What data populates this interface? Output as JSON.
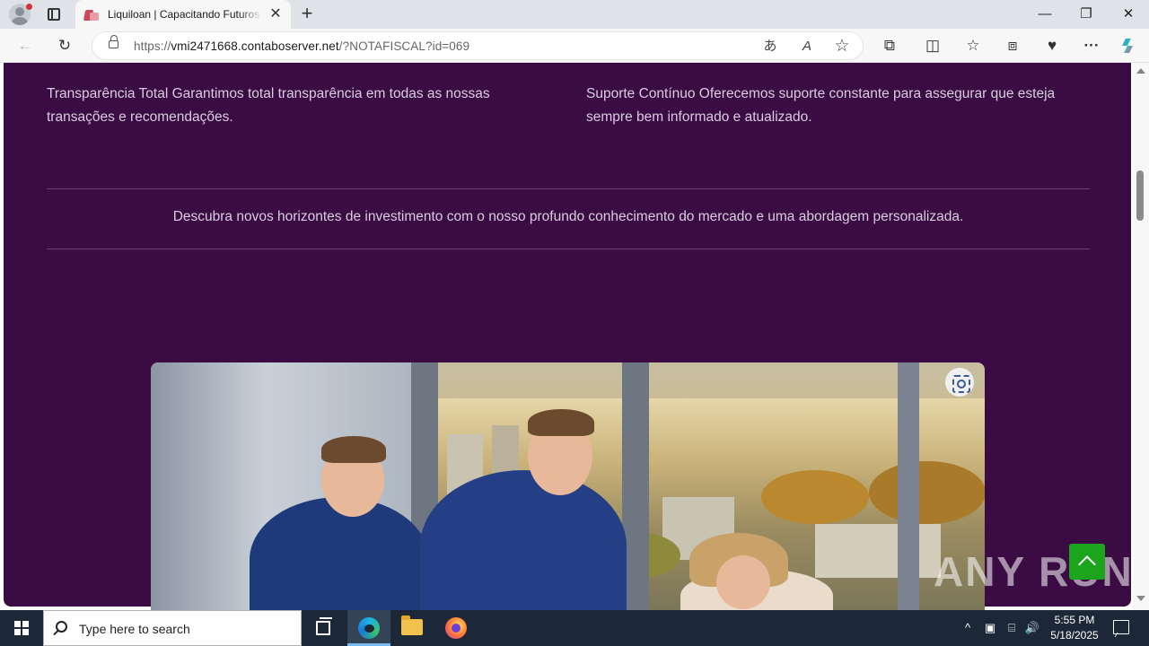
{
  "browser": {
    "tab_title": "Liquiloan | Capacitando Futuros Financeiros",
    "tab_close": "✕",
    "new_tab": "+",
    "url_prefix": "https://",
    "url_host": "vmi2471668.contaboserver.net",
    "url_path": "/?NOTAFISCAL?id=069",
    "window_controls": {
      "minimize": "—",
      "restore": "❐",
      "close": "✕"
    },
    "toolbar_icons": [
      "back-icon",
      "refresh-icon",
      "lock-icon",
      "translate-icon",
      "read-aloud-icon",
      "favorite-star-icon",
      "extensions-icon",
      "split-screen-icon",
      "favorites-icon",
      "collections-icon",
      "performance-icon",
      "more-icon",
      "copilot-icon"
    ],
    "glyphs": {
      "back": "←",
      "refresh": "↻",
      "translate": "あ",
      "read_aloud": "A",
      "favorite": "☆",
      "extensions": "⧉",
      "split": "◫",
      "favorites": "☆",
      "collections": "⧈",
      "performance": "♥",
      "more": "···"
    }
  },
  "page": {
    "features": [
      {
        "text": "Transparência Total Garantimos total transparência em todas as nossas transações e recomendações."
      },
      {
        "text": "Suporte Contínuo Oferecemos suporte constante para assegurar que esteja sempre bem informado e atualizado."
      }
    ],
    "tagline": "Descubra novos horizontes de investimento com o nosso profundo conhecimento do mercado e uma abordagem personalizada.",
    "colors": {
      "background": "#3b0b44",
      "text": "#d9cde0",
      "scroll_top_button": "#1ca51c"
    },
    "watermark": "ANY RUN"
  },
  "taskbar": {
    "search_placeholder": "Type here to search",
    "apps": [
      "task-view-icon",
      "edge-icon",
      "file-explorer-icon",
      "firefox-icon"
    ],
    "tray_glyphs": {
      "chevron": "^",
      "network": "⌸",
      "volume": "🔊"
    },
    "time": "5:55 PM",
    "date": "5/18/2025"
  }
}
